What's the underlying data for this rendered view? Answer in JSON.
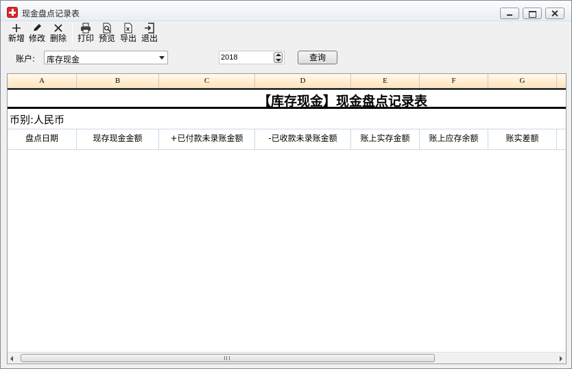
{
  "window": {
    "title": "现金盘点记录表"
  },
  "toolbar": {
    "buttons": [
      {
        "label": "新增",
        "icon": "plus-icon"
      },
      {
        "label": "修改",
        "icon": "pencil-icon"
      },
      {
        "label": "删除",
        "icon": "close-x-icon"
      },
      {
        "label": "打印",
        "icon": "printer-icon"
      },
      {
        "label": "预览",
        "icon": "preview-icon"
      },
      {
        "label": "导出",
        "icon": "excel-export-icon"
      },
      {
        "label": "退出",
        "icon": "exit-icon"
      }
    ]
  },
  "filter": {
    "account_label": "账户:",
    "account_value": "库存现金",
    "year_value": "2018",
    "query_label": "查询"
  },
  "grid": {
    "columns": [
      "A",
      "B",
      "C",
      "D",
      "E",
      "F",
      "G"
    ],
    "report_title": "【库存现金】现金盘点记录表",
    "currency_line": "币别:人民币",
    "headers": [
      "盘点日期",
      "现存现金金额",
      "+已付款未录账金额",
      "-已收款未录账金额",
      "账上实存金额",
      "账上应存余额",
      "账实差额"
    ],
    "accent_colors": {
      "column_header_bg": "#ffe3b8",
      "grid_line": "#c8d8e8"
    }
  },
  "scrollbar": {
    "grip": "III"
  }
}
